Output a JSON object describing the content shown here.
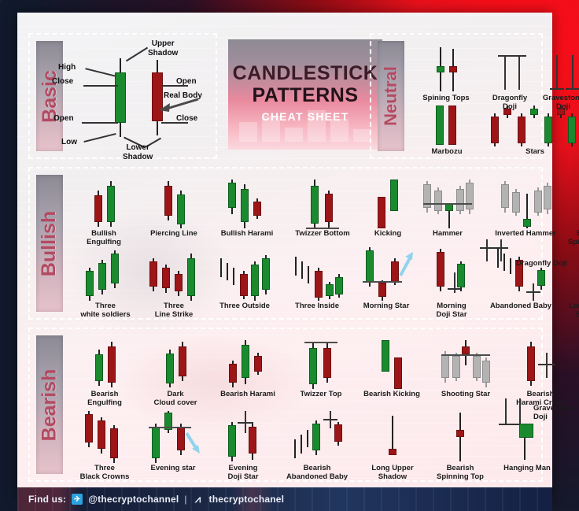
{
  "title": {
    "line1": "CANDLESTICK",
    "line2": "PATTERNS",
    "line3": "CHEAT SHEET"
  },
  "sections": {
    "basic": {
      "label": "Basic"
    },
    "neutral": {
      "label": "Neutral"
    },
    "bullish": {
      "label": "Bullish"
    },
    "bearish": {
      "label": "Bearish"
    }
  },
  "basic_labels": {
    "upper_shadow": "Upper\nShadow",
    "lower_shadow": "Lower\nShadow",
    "high": "High",
    "low": "Low",
    "close_left": "Close",
    "open_left": "Open",
    "open_right": "Open",
    "close_right": "Close",
    "real_body": "Real Body"
  },
  "neutral_patterns": [
    {
      "name": "Spining Tops"
    },
    {
      "name": "Dragonfly\nDoji"
    },
    {
      "name": "Gravestone\nDoji"
    },
    {
      "name": "Marbozu"
    },
    {
      "name": "Stars"
    }
  ],
  "bullish_patterns": [
    {
      "name": "Bullish\nEngulfing"
    },
    {
      "name": "Piercing Line"
    },
    {
      "name": "Bullish Harami"
    },
    {
      "name": "Twizzer Bottom"
    },
    {
      "name": "Kicking"
    },
    {
      "name": "Hammer"
    },
    {
      "name": "Inverted Hammer"
    },
    {
      "name": "Bullish\nSpining Top"
    },
    {
      "name": "Three\nwhite soldiers"
    },
    {
      "name": "Three\nLine Strike"
    },
    {
      "name": "Three Outside"
    },
    {
      "name": "Three Inside"
    },
    {
      "name": "Morning Star"
    },
    {
      "name": "Morning\nDoji Star"
    },
    {
      "name": "Abandoned Baby"
    },
    {
      "name": "Long Lower\nShadow"
    },
    {
      "name": "Dragonfly Doji"
    }
  ],
  "bearish_patterns": [
    {
      "name": "Bearish\nEngulfing"
    },
    {
      "name": "Dark\nCloud cover"
    },
    {
      "name": "Bearish Harami"
    },
    {
      "name": "Twizzer Top"
    },
    {
      "name": "Bearish Kicking"
    },
    {
      "name": "Shooting Star"
    },
    {
      "name": "Bearish\nHarami Cross"
    },
    {
      "name": "Gravestone\nDoji"
    },
    {
      "name": "Three\nBlack Crowns"
    },
    {
      "name": "Evening star"
    },
    {
      "name": "Evening\nDoji Star"
    },
    {
      "name": "Bearish\nAbandoned Baby"
    },
    {
      "name": "Long Upper\nShadow"
    },
    {
      "name": "Bearish\nSpinning Top"
    },
    {
      "name": "Hanging Man"
    }
  ],
  "footer": {
    "find_us": "Find us:",
    "telegram_icon": "telegram-icon",
    "telegram_handle": "@thecryptochannel",
    "separator": "|",
    "web_icon": "w-icon",
    "web_handle": "thecryptochanel"
  },
  "colors": {
    "bullish_green": "#1a8a2e",
    "bearish_red": "#9d1517",
    "neutral_gray": "#b3b3b3",
    "accent_pink": "#b34a62",
    "poster_bg": "#f6eef0"
  }
}
